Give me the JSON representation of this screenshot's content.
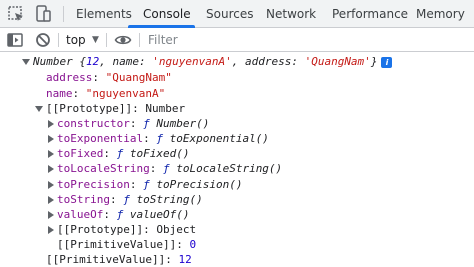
{
  "tabs": [
    {
      "label": "Elements"
    },
    {
      "label": "Console",
      "active": true
    },
    {
      "label": "Sources"
    },
    {
      "label": "Network"
    },
    {
      "label": "Performance"
    },
    {
      "label": "Memory"
    }
  ],
  "toolbar": {
    "context": "top",
    "filter_placeholder": "Filter"
  },
  "console": {
    "summary": {
      "prefix": "Number {",
      "value": "12",
      "sep1": ", ",
      "k1": "name",
      "colon1": ": ",
      "v1": "'nguyenvanA'",
      "sep2": ", ",
      "k2": "address",
      "colon2": ": ",
      "v2": "'QuangNam'",
      "suffix": "}",
      "badge": "i"
    },
    "props": [
      {
        "key": "address",
        "value": "\"QuangNam\""
      },
      {
        "key": "name",
        "value": "\"nguyenvanA\""
      }
    ],
    "prototype_label": "[[Prototype]]",
    "prototype_value": "Number",
    "methods": [
      {
        "key": "constructor",
        "fn": "Number()"
      },
      {
        "key": "toExponential",
        "fn": "toExponential()"
      },
      {
        "key": "toFixed",
        "fn": "toFixed()"
      },
      {
        "key": "toLocaleString",
        "fn": "toLocaleString()"
      },
      {
        "key": "toPrecision",
        "fn": "toPrecision()"
      },
      {
        "key": "toString",
        "fn": "toString()"
      },
      {
        "key": "valueOf",
        "fn": "valueOf()"
      }
    ],
    "f_glyph": "ƒ",
    "inner_prototype": {
      "key": "[[Prototype]]",
      "value": "Object"
    },
    "inner_primitive": {
      "key": "[[PrimitiveValue]]",
      "value": "0"
    },
    "outer_primitive": {
      "key": "[[PrimitiveValue]]",
      "value": "12"
    }
  },
  "icons": {
    "tabbar": [
      "inspect-element-icon",
      "device-toolbar-icon"
    ],
    "toolbar": [
      "sidebar-toggle-icon",
      "clear-console-icon",
      "eye-icon"
    ]
  }
}
